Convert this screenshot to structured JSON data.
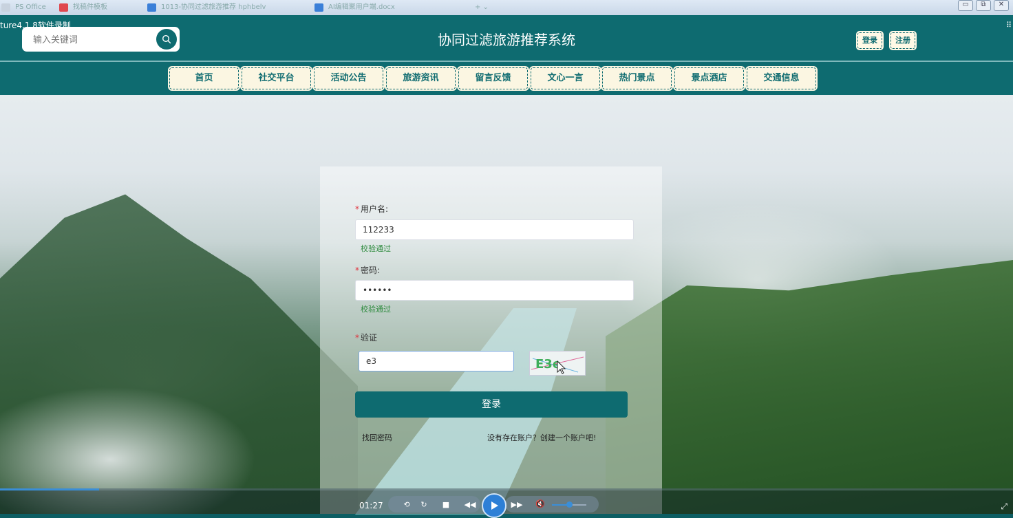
{
  "os": {
    "tabs": [
      "PS Office",
      "找稿件模板",
      "1013-协同过滤旅游推荐 hphbelv",
      "AI编辑聚用户端.docx"
    ],
    "tab_add": "+ ⌄",
    "controls": [
      "▭",
      "⧉",
      "✕"
    ]
  },
  "overlay": {
    "recorder_label": "ture4.1.8软件录制",
    "corner_icon": "⠿"
  },
  "header": {
    "search_placeholder": "输入关键词",
    "title": "协同过滤旅游推荐系统",
    "login_label": "登录",
    "register_label": "注册"
  },
  "nav": {
    "items": [
      "首页",
      "社交平台",
      "活动公告",
      "旅游资讯",
      "留言反馈",
      "文心一言",
      "热门景点",
      "景点酒店",
      "交通信息"
    ]
  },
  "login": {
    "username_label": "用户名:",
    "username_value": "112233",
    "username_valid": "校验通过",
    "password_label": "密码:",
    "password_value": "••••••",
    "password_valid": "校验通过",
    "captcha_label": "验证",
    "captcha_value": "e3",
    "captcha_text": "E3e",
    "submit_label": "登录",
    "forgot_label": "找回密码",
    "register_link": "没有存在账户？创建一个账户吧!"
  },
  "player": {
    "time": "01:27",
    "progress": 0.098,
    "volume": 0.5,
    "buttons": [
      "⟲",
      "↻",
      "■",
      "◀◀",
      "▶▶",
      "🔇"
    ],
    "fullscreen": "⤢"
  },
  "colors": {
    "brand": "#0e6b70",
    "button_bg": "#fbf6e2",
    "valid": "#2e8b3e",
    "required": "#e0323c",
    "accent": "#2d7fd6"
  }
}
